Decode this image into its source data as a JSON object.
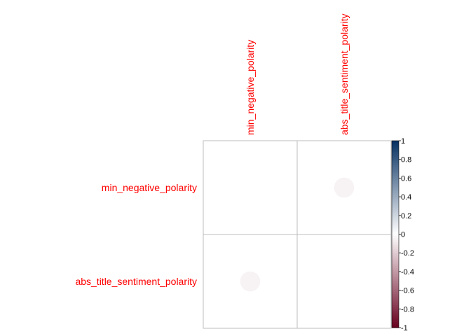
{
  "chart_data": {
    "type": "heatmap",
    "title": "",
    "variables": [
      "min_negative_polarity",
      "abs_title_sentiment_polarity"
    ],
    "matrix": [
      [
        null,
        -0.05
      ],
      [
        -0.05,
        null
      ]
    ],
    "color_scale": {
      "min": -1,
      "max": 1,
      "ticks": [
        "-1",
        "-0.8",
        "-0.6",
        "-0.4",
        "-0.2",
        "0",
        "0.2",
        "0.4",
        "0.6",
        "0.8",
        "1"
      ],
      "low_color": "#67001f",
      "mid_color": "#ffffff",
      "high_color": "#053061"
    },
    "label_color": "#ff0000",
    "grid": true,
    "legend_position": "right"
  }
}
